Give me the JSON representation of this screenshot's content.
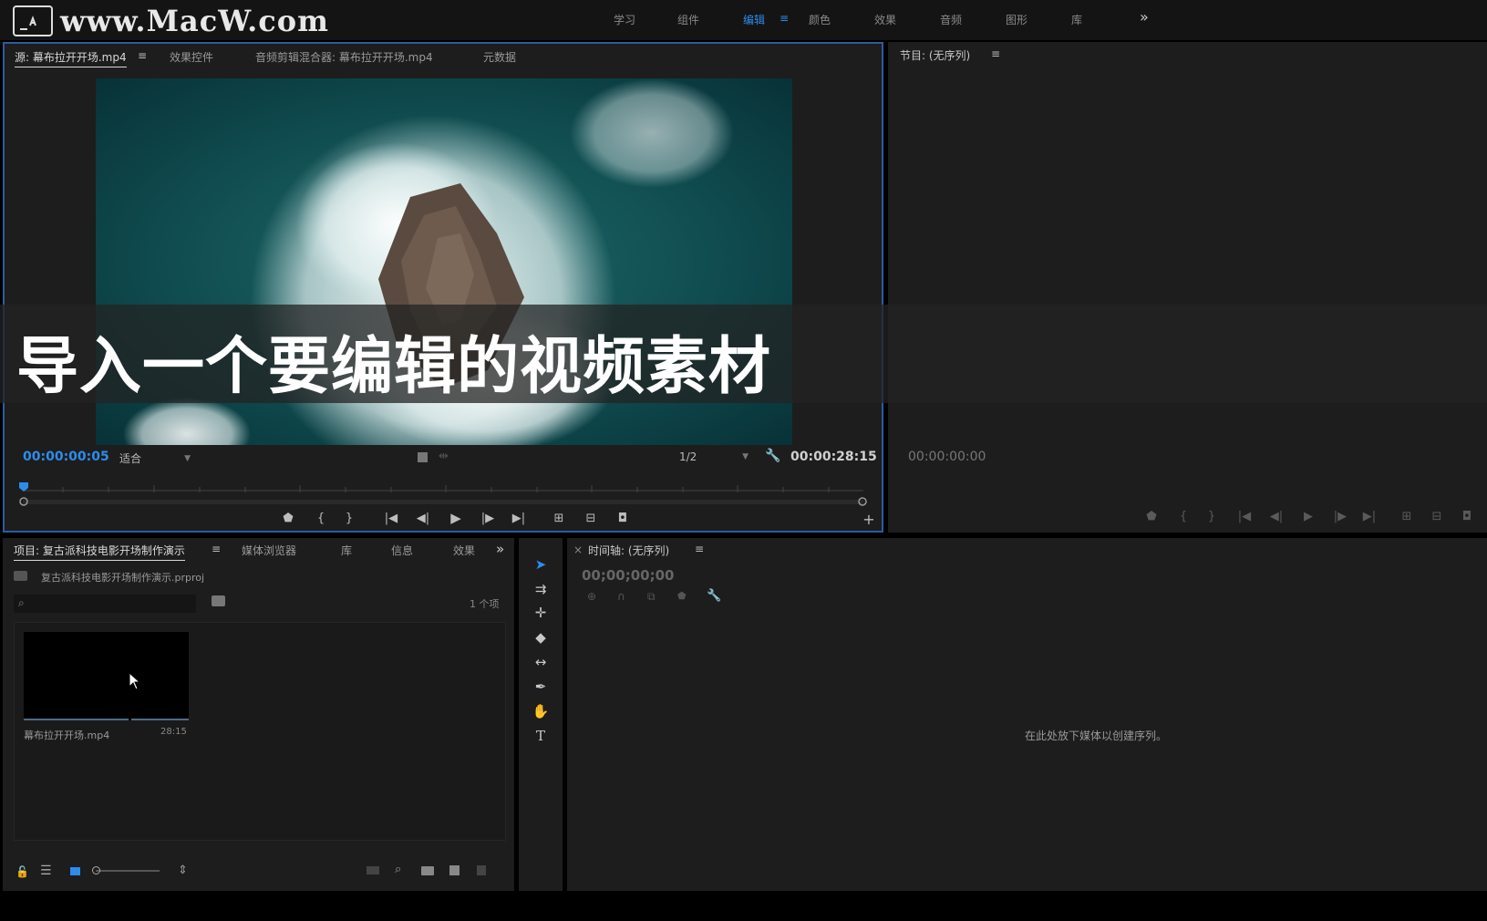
{
  "watermark": {
    "text": "www.MacW.com"
  },
  "workspaces": {
    "items": [
      {
        "label": "学习"
      },
      {
        "label": "组件"
      },
      {
        "label": "编辑"
      },
      {
        "label": "颜色"
      },
      {
        "label": "效果"
      },
      {
        "label": "音频"
      },
      {
        "label": "图形"
      },
      {
        "label": "库"
      }
    ],
    "active": "编辑",
    "menu_glyph": "≡",
    "overflow_glyph": "»"
  },
  "source_panel": {
    "tabs": [
      {
        "label": "源: 幕布拉开开场.mp4"
      },
      {
        "label": "效果控件"
      },
      {
        "label": "音频剪辑混合器: 幕布拉开开场.mp4"
      },
      {
        "label": "元数据"
      }
    ],
    "menu_glyph": "≡",
    "current_timecode": "00:00:00:05",
    "zoom_select": "适合",
    "resolution_select": "1/2",
    "duration_timecode": "00:00:28:15",
    "playhead_fraction": 0.0
  },
  "program_panel": {
    "tab": "节目: (无序列)",
    "menu_glyph": "≡",
    "timecode": "00:00:00:00"
  },
  "caption": {
    "text": "导入一个要编辑的视频素材"
  },
  "project_panel": {
    "tabs": [
      {
        "label": "项目: 复古派科技电影开场制作演示"
      },
      {
        "label": "媒体浏览器"
      },
      {
        "label": "库"
      },
      {
        "label": "信息"
      },
      {
        "label": "效果"
      }
    ],
    "menu_glyph": "≡",
    "overflow_glyph": "»",
    "project_file": "复古派科技电影开场制作演示.prproj",
    "search_placeholder": "",
    "item_count": "1 个项",
    "clip": {
      "name": "幕布拉开开场.mp4",
      "duration": "28:15"
    }
  },
  "timeline_panel": {
    "close_glyph": "×",
    "tab": "时间轴: (无序列)",
    "menu_glyph": "≡",
    "timecode": "00;00;00;00",
    "drop_hint": "在此处放下媒体以创建序列。"
  },
  "colors": {
    "accent": "#2d8ceb",
    "panel_bg": "#1d1d1d",
    "app_bg": "#000000",
    "focus_border": "#2e5a9e"
  }
}
